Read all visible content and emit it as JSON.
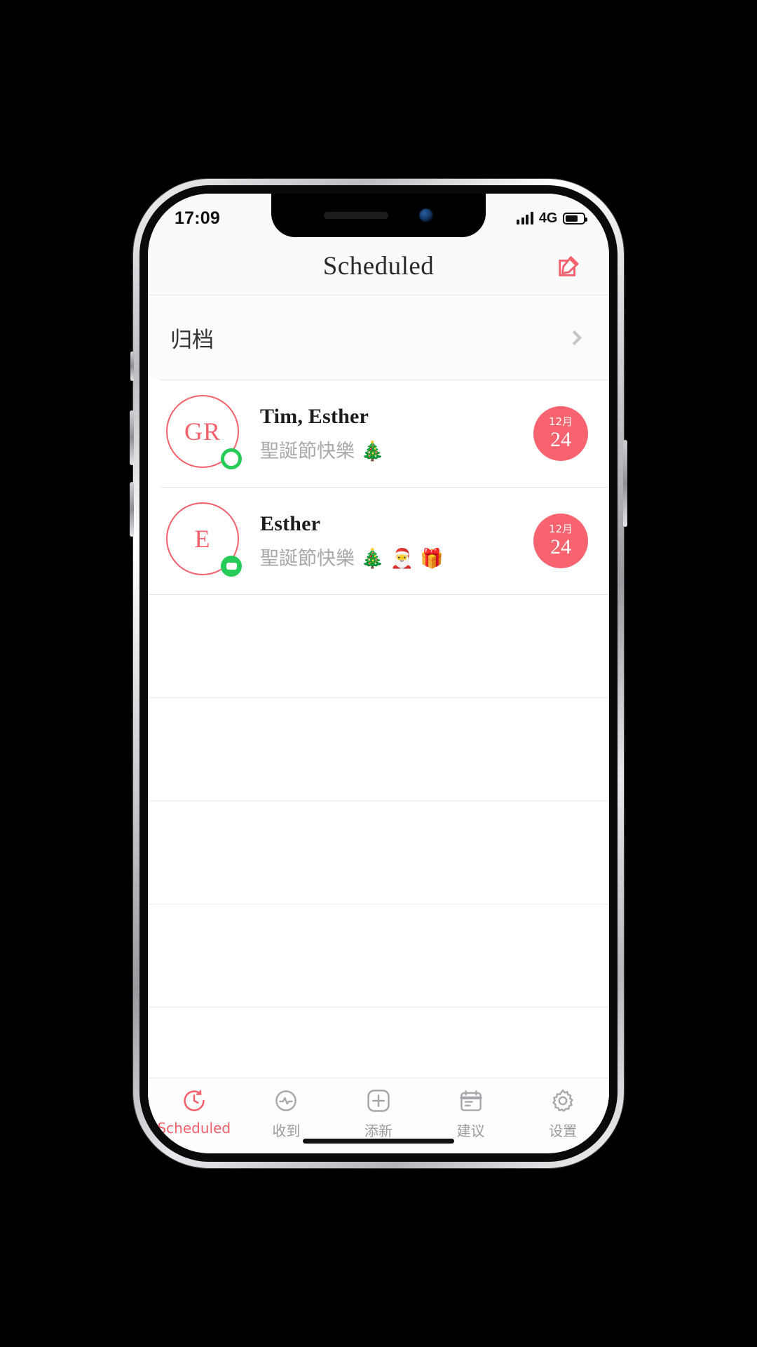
{
  "status_bar": {
    "time": "17:09",
    "network": "4G",
    "signal_icon": "signal-bars-icon",
    "battery_icon": "battery-icon",
    "battery_level": 70
  },
  "nav": {
    "title": "Scheduled",
    "compose_icon": "compose-pencil-icon",
    "accent_color": "#f4606c"
  },
  "archive": {
    "label": "归档",
    "chevron_icon": "chevron-right-icon"
  },
  "messages": [
    {
      "avatar_initials": "GR",
      "name": "Tim, Esther",
      "preview": "聖誕節快樂 🎄",
      "presence": "online-ring",
      "date_month": "12月",
      "date_day": "24"
    },
    {
      "avatar_initials": "E",
      "name": "Esther",
      "preview": "聖誕節快樂 🎄 🎅 🎁",
      "presence": "chat-bubble",
      "date_month": "12月",
      "date_day": "24"
    }
  ],
  "tabs": [
    {
      "label": "Scheduled",
      "icon": "clock-icon",
      "active": true
    },
    {
      "label": "收到",
      "icon": "inbox-pulse-icon",
      "active": false
    },
    {
      "label": "添新",
      "icon": "plus-circle-icon",
      "active": false
    },
    {
      "label": "建议",
      "icon": "calendar-icon",
      "active": false
    },
    {
      "label": "设置",
      "icon": "gear-icon",
      "active": false
    }
  ]
}
